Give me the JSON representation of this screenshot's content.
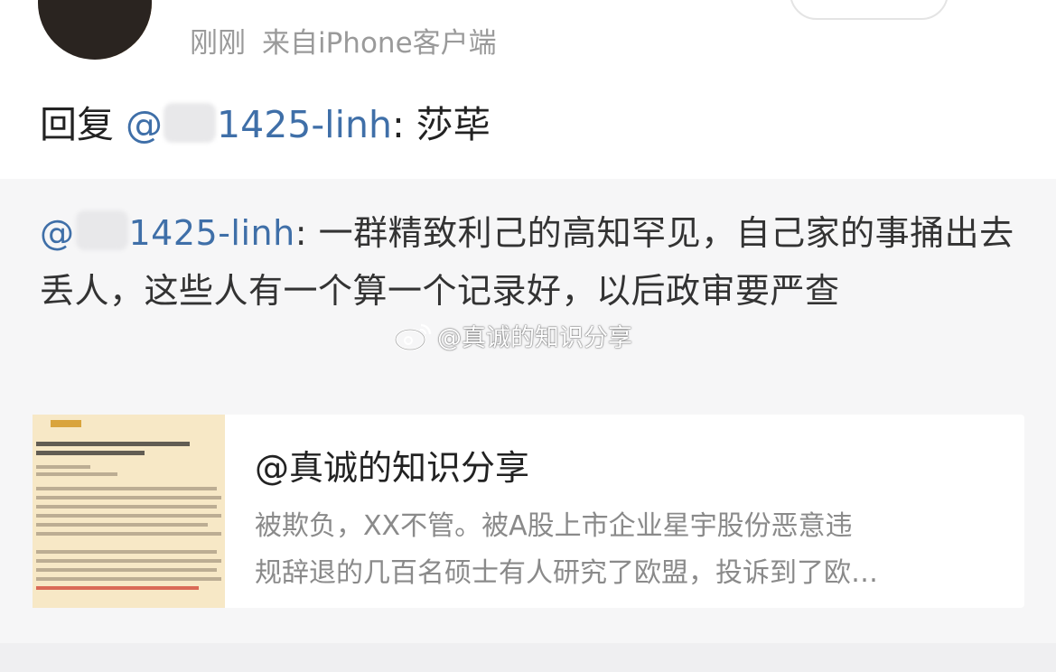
{
  "post": {
    "time": "刚刚",
    "source": "来自iPhone客户端"
  },
  "reply": {
    "prefix": "回复",
    "mention_start": "@",
    "mention_end": "1425-linh",
    "colon_text": ": 莎荜"
  },
  "quoted": {
    "mention_start": "@",
    "mention_end": "1425-linh",
    "text": ": 一群精致利己的高知罕见，自己家的事捅出去丢人，这些人有一个算一个记录好，以后政审要严查"
  },
  "watermark": {
    "text": "@真诚的知识分享",
    "icon": "weibo-icon"
  },
  "card": {
    "title": "@真诚的知识分享",
    "desc_line1": "被欺负，XX不管。被A股上市企业星宇股份恶意违",
    "desc_line2": "规辞退的几百名硕士有人研究了欧盟，投诉到了欧…",
    "thumbnail": "document-screenshot-image"
  },
  "colors": {
    "mention": "#3f6fa8",
    "meta": "#9a9a9a",
    "quote_bg": "#f6f6f7"
  }
}
